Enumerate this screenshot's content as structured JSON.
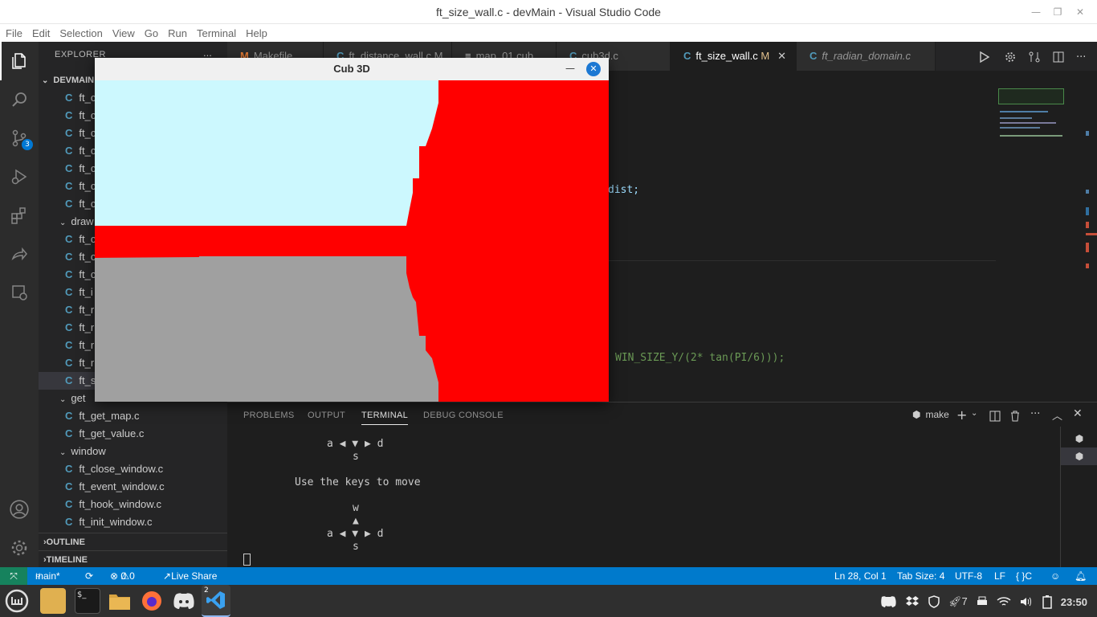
{
  "window": {
    "title": "ft_size_wall.c - devMain - Visual Studio Code",
    "minimize": "—",
    "maximize": "❐",
    "close": "✕"
  },
  "menu": [
    "File",
    "Edit",
    "Selection",
    "View",
    "Go",
    "Run",
    "Terminal",
    "Help"
  ],
  "activity": {
    "items": [
      "files-icon",
      "search-icon",
      "source-control-icon",
      "run-debug-icon",
      "extensions-icon",
      "live-share-icon",
      "remote-explorer-icon",
      "account-icon",
      "settings-gear-icon"
    ],
    "scm_badge": "3"
  },
  "sidebar": {
    "header": "EXPLORER",
    "more": "...",
    "root": "DEVMAIN",
    "items": [
      {
        "type": "file",
        "label": "ft_c"
      },
      {
        "type": "file",
        "label": "ft_c"
      },
      {
        "type": "file",
        "label": "ft_c"
      },
      {
        "type": "file",
        "label": "ft_c"
      },
      {
        "type": "file",
        "label": "ft_c"
      },
      {
        "type": "file",
        "label": "ft_c"
      },
      {
        "type": "file",
        "label": "ft_c"
      },
      {
        "type": "folder",
        "label": "draw"
      },
      {
        "type": "file",
        "label": "ft_c"
      },
      {
        "type": "file",
        "label": "ft_c"
      },
      {
        "type": "file",
        "label": "ft_c"
      },
      {
        "type": "file",
        "label": "ft_i"
      },
      {
        "type": "file",
        "label": "ft_r"
      },
      {
        "type": "file",
        "label": "ft_r"
      },
      {
        "type": "file",
        "label": "ft_r"
      },
      {
        "type": "file",
        "label": "ft_r"
      },
      {
        "type": "file",
        "label": "ft_s"
      },
      {
        "type": "folder",
        "label": "get"
      },
      {
        "type": "file",
        "label": "ft_get_map.c"
      },
      {
        "type": "file",
        "label": "ft_get_value.c"
      },
      {
        "type": "folder",
        "label": "window"
      },
      {
        "type": "file",
        "label": "ft_close_window.c"
      },
      {
        "type": "file",
        "label": "ft_event_window.c"
      },
      {
        "type": "file",
        "label": "ft_hook_window.c"
      },
      {
        "type": "file",
        "label": "ft_init_window.c"
      }
    ],
    "outline": "OUTLINE",
    "timeline": "TIMELINE"
  },
  "tabs": [
    {
      "label": "Makefile",
      "badge": "M"
    },
    {
      "label": "ft_distance_wall.c",
      "badge": "M"
    },
    {
      "label": "map_01.cub",
      "badge": ""
    },
    {
      "label": "cub3d.c",
      "badge": ""
    },
    {
      "label": "ft_size_wall.c",
      "badge": "M"
    },
    {
      "label": "ft_radian_domain.c",
      "badge": ""
    }
  ],
  "editor": {
    "line_dist": "dist;",
    "line_win": "WIN_SIZE_Y/(2* tan(PI/6)));"
  },
  "panel": {
    "tabs": [
      "PROBLEMS",
      "OUTPUT",
      "TERMINAL",
      "DEBUG CONSOLE"
    ],
    "active_tab": "TERMINAL",
    "terminal_name": "make",
    "terminal": {
      "line1": "a ◀ ▼ ▶ d",
      "line2": "s",
      "line3": "Use the keys to move",
      "line4": "w",
      "line5": "▲",
      "line6": "a ◀ ▼ ▶ d",
      "line7": "s"
    }
  },
  "statusbar": {
    "branch": "main*",
    "errors": "0",
    "warnings": "0",
    "liveshare": "Live Share",
    "position": "Ln 28, Col 1",
    "tabsize": "Tab Size: 4",
    "encoding": "UTF-8",
    "eol": "LF",
    "language": "C"
  },
  "cubwindow": {
    "title": "Cub 3D",
    "minimize": "—",
    "colors": {
      "sky": "#ccf8fe",
      "wall": "#ff0000",
      "floor": "#a0a0a0"
    }
  },
  "taskbar": {
    "apps": [
      "linux-mint-menu-icon",
      "file-folder-icon",
      "terminal-icon",
      "files-manager-icon",
      "firefox-icon",
      "discord-icon",
      "vscode-icon"
    ],
    "vscode_count": "2",
    "tray_count": "7",
    "clock": "23:50"
  }
}
